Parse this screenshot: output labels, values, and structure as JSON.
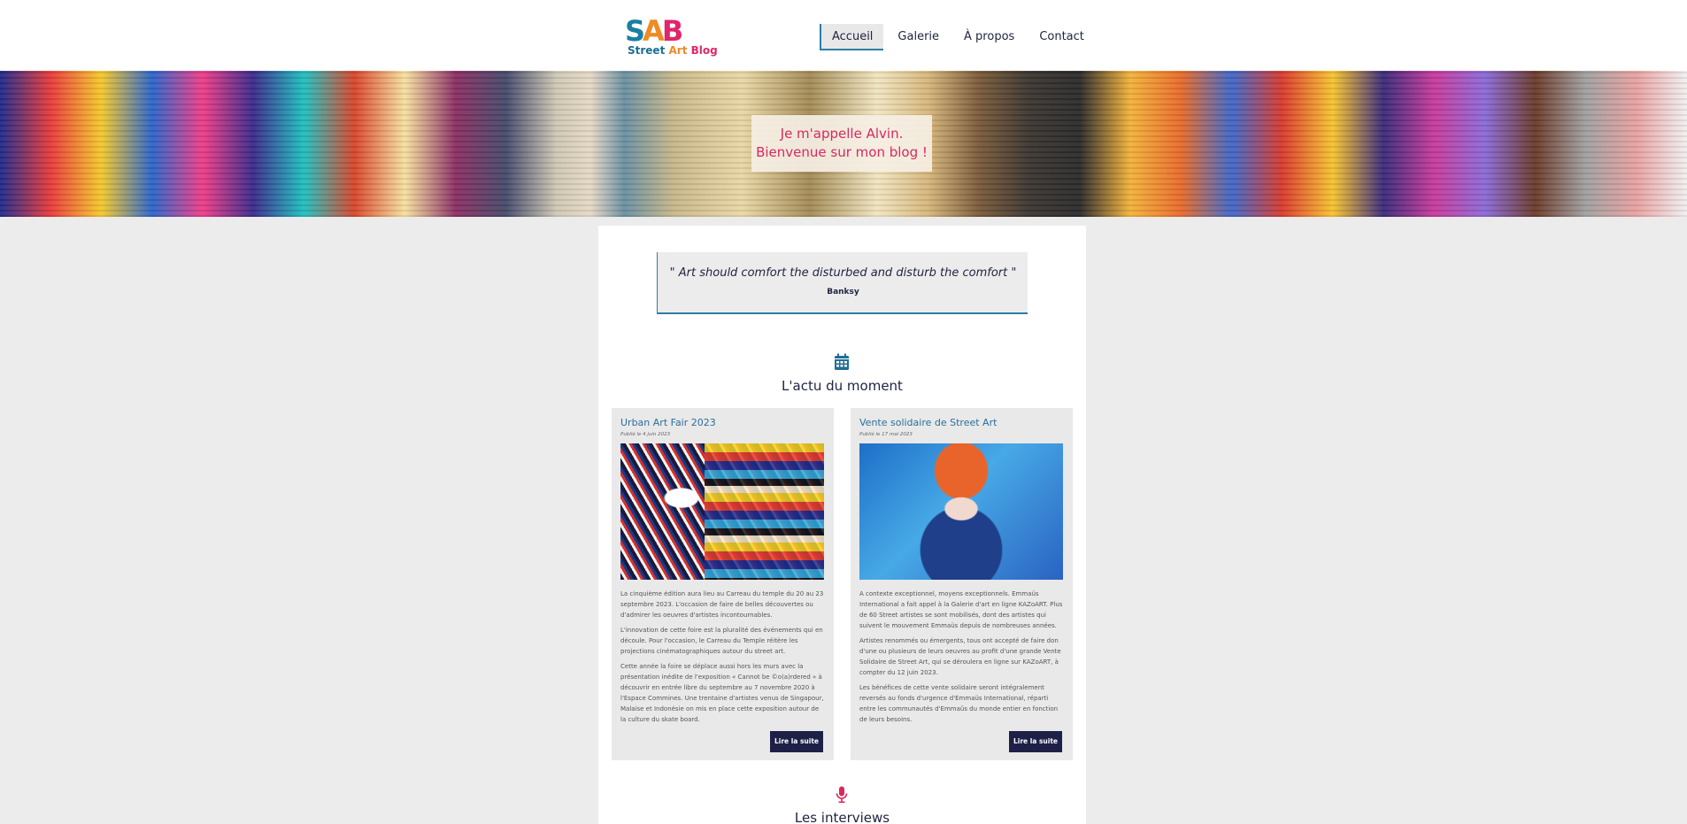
{
  "header": {
    "logo": {
      "letters": [
        "S",
        "A",
        "B"
      ],
      "words": [
        "Street",
        "Art",
        "Blog"
      ]
    },
    "nav": [
      {
        "label": "Accueil",
        "active": true
      },
      {
        "label": "Galerie",
        "active": false
      },
      {
        "label": "À propos",
        "active": false
      },
      {
        "label": "Contact",
        "active": false
      }
    ]
  },
  "hero": {
    "line1": "Je m'appelle Alvin.",
    "line2": "Bienvenue sur mon blog !"
  },
  "quote": {
    "text": "\" Art should comfort the disturbed and disturb the comfort \"",
    "author": "Banksy"
  },
  "news": {
    "icon": "calendar-icon",
    "title": "L'actu du moment",
    "articles": [
      {
        "title": "Urban Art Fair 2023",
        "date": "Publié le 4 juin 2023",
        "paragraphs": [
          "La cinquième édition aura lieu au Carreau du temple du 20 au 23 septembre 2023. L'occasion de faire de belles découvertes ou d'admirer les oeuvres d'artistes incontournables.",
          "L'innovation de cette foire est la pluralité des événements qui en découle. Pour l'occasion, le Carreau du Temple réitère les projections cinématographiques autour du street art.",
          "Cette année la foire se déplace aussi hors les murs avec la présentation inédite de l'exposition « Cannot be ©o(a)rdered » à découvrir en entrée libre du septembre au 7 novembre 2020 à l'Espace Commines. Une trentaine d'artistes venus de Singapour, Malaise et Indonésie on mis en place cette exposition autour de la culture du skate board."
        ],
        "button": "Lire la suite"
      },
      {
        "title": "Vente solidaire de Street Art",
        "date": "Publié le 17 mai 2023",
        "paragraphs": [
          "A contexte exceptionnel, moyens exceptionnels. Emmaüs International a fait appel à la Galerie d'art en ligne KAZoART. Plus de 60 Street artistes se sont mobilisés, dont des artistes qui suivent le mouvement Emmaüs depuis de nombreuses années.",
          "Artistes renommés ou émergents, tous ont accepté de faire don d'une ou plusieurs de leurs oeuvres au profit d'une grande Vente Solidaire de Street Art, qui se déroulera en ligne sur KAZoART, à compter du 12 juin 2023.",
          "Les bénéfices de cette vente solidaire seront intégralement reversés au fonds d'urgence d'Emmaüs International, réparti entre les communautés d'Emmaüs du monde entier en fonction de leurs besoins."
        ],
        "button": "Lire la suite"
      }
    ]
  },
  "interviews": {
    "icon": "microphone-icon",
    "title": "Les interviews"
  },
  "colors": {
    "accent_blue": "#2a7fa8",
    "accent_pink": "#d9285f",
    "navy": "#1f2048",
    "page_bg": "#ececec"
  }
}
